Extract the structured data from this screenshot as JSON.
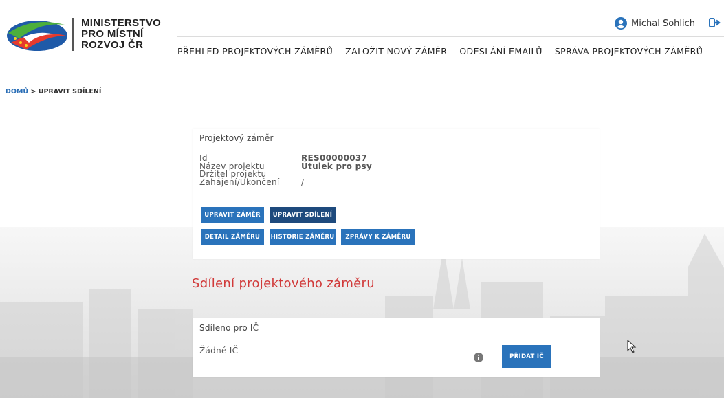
{
  "header": {
    "logo_lines": [
      "MINISTERSTVO",
      "PRO MÍSTNÍ",
      "ROZVOJ ČR"
    ],
    "user_name": "Michal Sohlich",
    "nav": [
      "PŘEHLED PROJEKTOVÝCH ZÁMĚRŮ",
      "ZALOŽIT NOVÝ ZÁMĚR",
      "ODESLÁNÍ EMAILŮ",
      "SPRÁVA PROJEKTOVÝCH ZÁMĚRŮ"
    ]
  },
  "breadcrumb": {
    "home": "DOMŮ",
    "separator": ">",
    "current": "UPRAVIT SDÍLENÍ"
  },
  "project_card": {
    "title": "Projektový záměr",
    "fields": [
      {
        "label": "Id",
        "value": "RES00000037"
      },
      {
        "label": "Název projektu",
        "value": "Útulek pro psy"
      },
      {
        "label": "Držitel projektu",
        "value": ""
      },
      {
        "label": "Zahájení/Ukončení",
        "value": "/"
      }
    ],
    "buttons": {
      "edit_plan": "UPRAVIT ZÁMĚR",
      "edit_sharing": "UPRAVIT SDÍLENÍ",
      "detail": "DETAIL ZÁMĚRU",
      "history": "HISTORIE ZÁMĚRU",
      "messages": "ZPRÁVY K ZÁMĚRU"
    }
  },
  "sharing": {
    "section_title": "Sdílení projektového záměru",
    "card_title": "Sdíleno pro IČ",
    "none_label": "Žádné IČ",
    "ic_value": "",
    "add_button": "PŘIDAT IČ"
  },
  "colors": {
    "primary_button": "#2a73bb",
    "active_button": "#1e4a7d",
    "section_title": "#d13a3a",
    "link": "#2a6eb6"
  }
}
